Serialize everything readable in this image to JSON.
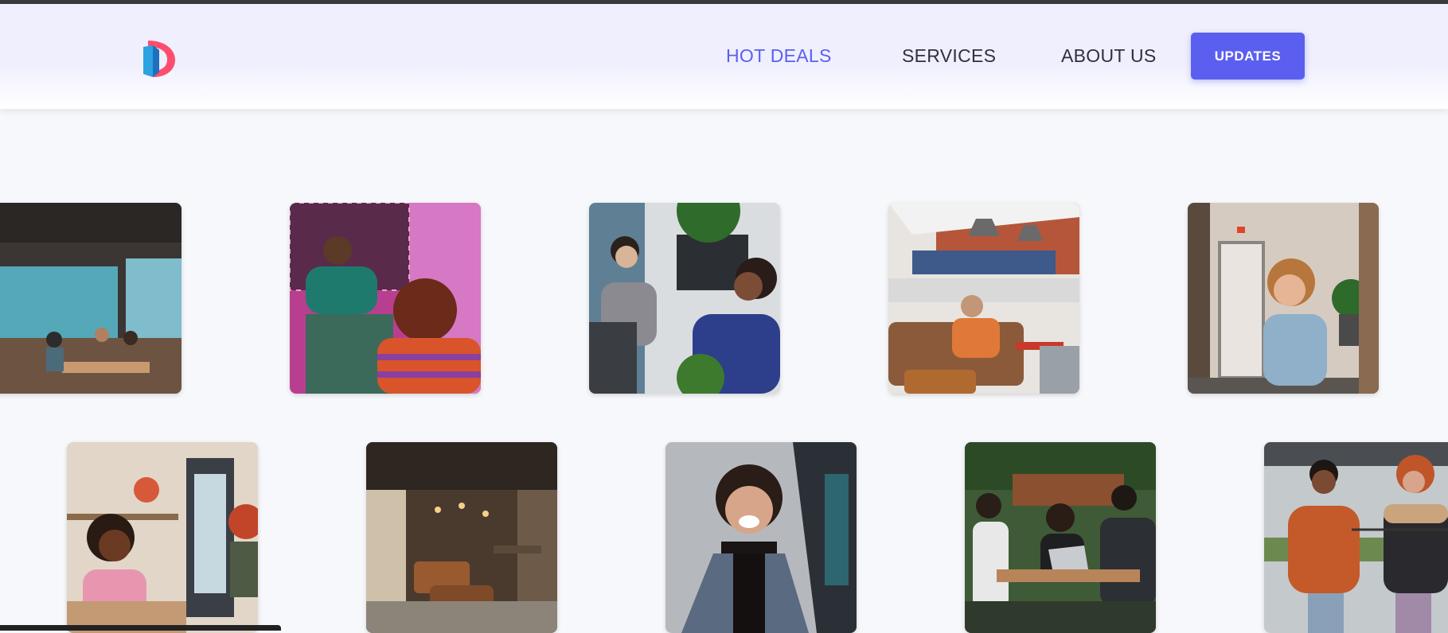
{
  "header": {
    "logo": {
      "icon": "d-letter-logo-icon"
    },
    "nav": [
      {
        "label": "HOT DEALS",
        "active": true
      },
      {
        "label": "SERVICES",
        "active": false
      },
      {
        "label": "ABOUT US",
        "active": false
      }
    ],
    "cta_label": "UPDATES"
  },
  "gallery": {
    "row1": [
      {
        "subject": "cafe interior with people at tables"
      },
      {
        "subject": "two people talking in a colorful room"
      },
      {
        "subject": "two coworkers at a desk"
      },
      {
        "subject": "people on a couch in an open office"
      },
      {
        "subject": "smiling woman leaning on a ledge"
      }
    ],
    "row2": [
      {
        "subject": "two women in a kitchen"
      },
      {
        "subject": "lounge with sofas and lamps"
      },
      {
        "subject": "laughing woman in a denim jacket"
      },
      {
        "subject": "friends at an outdoor cafe table"
      },
      {
        "subject": "two people laughing on a terrace"
      }
    ]
  },
  "colors": {
    "accent": "#5b5ff0",
    "nav_text": "#2e3140",
    "background": "#f7f8fb"
  }
}
